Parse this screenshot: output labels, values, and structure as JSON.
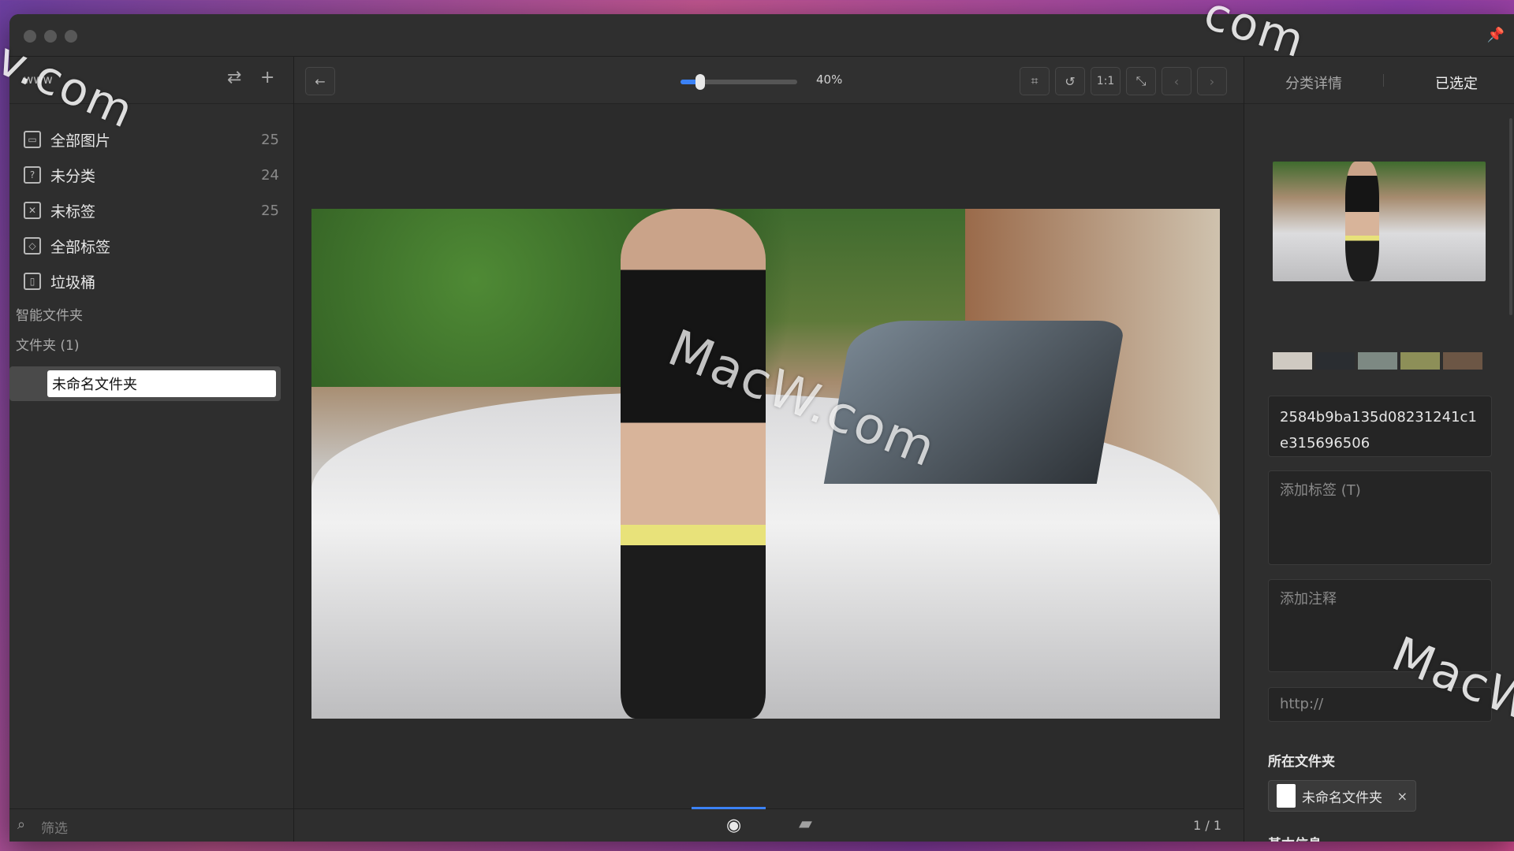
{
  "sidebar": {
    "library_name": "www",
    "items": [
      {
        "label": "全部图片",
        "count": "25",
        "icon": "images-icon"
      },
      {
        "label": "未分类",
        "count": "24",
        "icon": "uncategorized-icon"
      },
      {
        "label": "未标签",
        "count": "25",
        "icon": "untagged-icon"
      },
      {
        "label": "全部标签",
        "count": "",
        "icon": "tags-icon"
      },
      {
        "label": "垃圾桶",
        "count": "",
        "icon": "trash-icon"
      }
    ],
    "smart_folders_label": "智能文件夹",
    "folders_label": "文件夹 (1)",
    "folder_input_value": "未命名文件夹",
    "filter_placeholder": "筛选"
  },
  "toolbar": {
    "zoom_text": "40%",
    "zoom_fraction": 0.17,
    "one_to_one_label": "1:1"
  },
  "viewer": {
    "pager": "1 / 1"
  },
  "right_panel": {
    "tab_details": "分类详情",
    "tab_selected": "已选定",
    "colors": [
      "#cfcac2",
      "#2a2d31",
      "#7d8983",
      "#8d8f58",
      "#6c5645"
    ],
    "hash": "2584b9ba135d08231241c1e315696506",
    "tags_placeholder": "添加标签 (T)",
    "notes_placeholder": "添加注释",
    "url_placeholder": "http://",
    "folder_heading": "所在文件夹",
    "folder_chip": "未命名文件夹",
    "folder_chip_close": "×",
    "basic_info": "基本信息"
  },
  "watermarks": {
    "top_left": "v.com",
    "top_right": "com",
    "center": "MacW.com",
    "bottom_right": "MacW"
  }
}
